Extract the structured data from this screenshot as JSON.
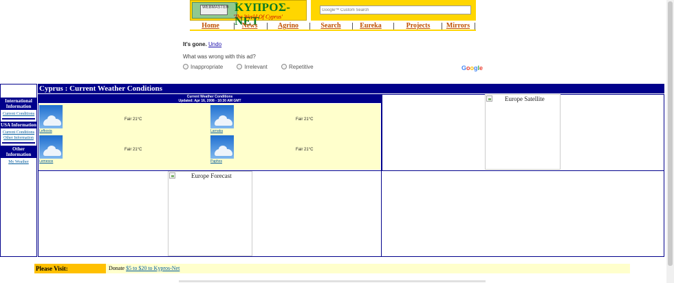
{
  "logo": {
    "title": "ΚΥΠΡΟΣ-NET",
    "subtitle": "'The World Of Cyprus'",
    "banner_text": "WEBMASTER"
  },
  "search": {
    "placeholder": "Google™ Custom Search"
  },
  "nav": {
    "items": [
      {
        "label": "Home"
      },
      {
        "label": "News"
      },
      {
        "label": "Agrino"
      },
      {
        "label": "Search"
      },
      {
        "label": "Eureka"
      },
      {
        "label": "Projects"
      },
      {
        "label": "Mirrors"
      }
    ]
  },
  "ad_notice": {
    "gone_text": "It's gone.",
    "undo_label": "Undo",
    "question": "What was wrong with this ad?",
    "options": [
      "Inappropriate",
      "Irrelevant",
      "Repetitive"
    ],
    "provider": "Google"
  },
  "page": {
    "title": "Cyprus : Current Weather Conditions"
  },
  "sidebar": {
    "sections": [
      {
        "heading": "International Information",
        "links": [
          "Current Conditions"
        ]
      },
      {
        "heading": "USA Information",
        "links": [
          "Current Conditions",
          "Other Information"
        ]
      },
      {
        "heading": "Other Information",
        "links": [
          "My Weather"
        ]
      }
    ]
  },
  "weather": {
    "heading": "Current Weather Conditions",
    "updated": "Updated: Apr 16, 2008 - 10:30 AM GMT",
    "cities": [
      {
        "name": "Lefkosia",
        "condition": "Fair 21°C"
      },
      {
        "name": "Larnaka",
        "condition": "Fair 21°C"
      },
      {
        "name": "Lemesos",
        "condition": "Fair 21°C"
      },
      {
        "name": "Paphos",
        "condition": "Fair 21°C"
      }
    ]
  },
  "images": {
    "satellite_alt": "Europe Satellite",
    "forecast_alt": "Europe Forecast"
  },
  "visit": {
    "label": "Please Visit:",
    "donate_prefix": "Donate",
    "donate_link": "$5 to $20 to Kypros-Net"
  },
  "colors": {
    "navy": "#00008b",
    "yellow": "#ffd600",
    "cream": "#ffffcc",
    "orange": "#ffc000"
  }
}
